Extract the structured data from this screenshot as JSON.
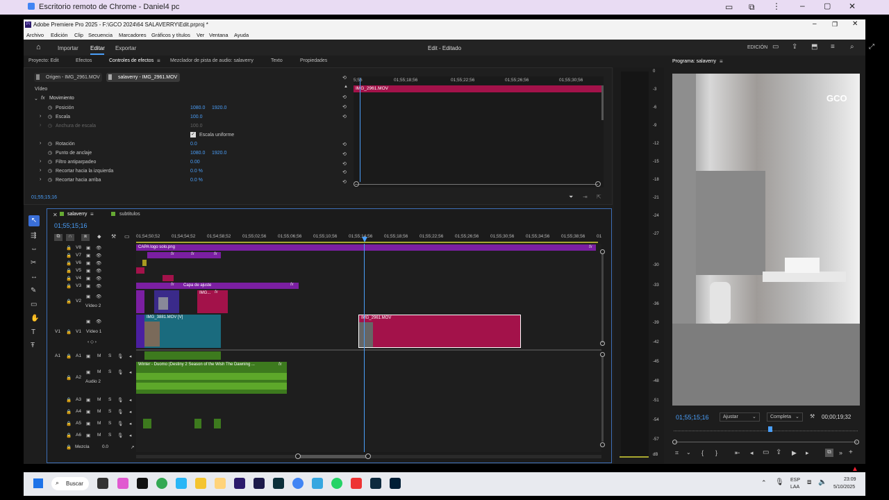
{
  "remote_desktop": {
    "title": "Escritorio remoto de Chrome - Daniel4 pc"
  },
  "app": {
    "title": "Adobe Premiere Pro 2025 - F:\\GCO 2024\\64 SALAVERRY\\Edit.prproj *",
    "menu": [
      "Archivo",
      "Edición",
      "Clip",
      "Secuencia",
      "Marcadores",
      "Gráficos y títulos",
      "Ver",
      "Ventana",
      "Ayuda"
    ],
    "nav": {
      "import": "Importar",
      "edit": "Editar",
      "export": "Exportar"
    },
    "workspace_title": "Edit - Editado",
    "edition_label": "EDICIÓN"
  },
  "panel_tabs": [
    "Proyecto: Edit",
    "Efectos",
    "Controles de efectos",
    "Mezclador de pista de audio: salaverry",
    "Texto",
    "Propiedades"
  ],
  "effect_controls": {
    "source_tab": "Origen - IMG_2961.MOV",
    "seq_tab": "salaverry - IMG_2961.MOV",
    "section": "Vídeo",
    "motion": "Movimiento",
    "rows": [
      {
        "label": "Posición",
        "v1": "1080.0",
        "v2": "1920.0"
      },
      {
        "label": "Escala",
        "v1": "100.0",
        "v2": ""
      },
      {
        "label": "Anchura de escala",
        "v1": "100.0",
        "v2": ""
      },
      {
        "label": "Escala uniforme",
        "v1": "",
        "v2": ""
      },
      {
        "label": "Rotación",
        "v1": "0.0",
        "v2": ""
      },
      {
        "label": "Punto de anclaje",
        "v1": "1080.0",
        "v2": "1920.0"
      },
      {
        "label": "Filtro antiparpadeo",
        "v1": "0.00",
        "v2": ""
      },
      {
        "label": "Recortar hacia la izquierda",
        "v1": "0.0 %",
        "v2": ""
      },
      {
        "label": "Recortar hacia arriba",
        "v1": "0.0 %",
        "v2": ""
      }
    ],
    "timecode": "01;55;15;16",
    "mini_ruler": [
      "5;56",
      "01;55;18;56",
      "01;55;22;56",
      "01;55;26;56",
      "01;55;30;56"
    ],
    "mini_clip": "IMG_2961.MOV"
  },
  "timeline": {
    "tabs": [
      "salaverry",
      "subtitulos"
    ],
    "timecode": "01;55;15;16",
    "ruler": [
      "01;54;50;52",
      "01;54;54;52",
      "01;54;58;52",
      "01;55;02;56",
      "01;55;06;56",
      "01;55;10;56",
      "01;55;14;56",
      "01;55;18;56",
      "01;55;22;56",
      "01;55;26;56",
      "01;55;30;56",
      "01;55;34;56",
      "01;55;38;56",
      "01"
    ],
    "video_tracks": [
      {
        "id": "V8",
        "label": ""
      },
      {
        "id": "V7",
        "label": ""
      },
      {
        "id": "V6",
        "label": ""
      },
      {
        "id": "V5",
        "label": ""
      },
      {
        "id": "V4",
        "label": ""
      },
      {
        "id": "V3",
        "label": ""
      },
      {
        "id": "V2",
        "label": "Vídeo 2"
      },
      {
        "id": "V1",
        "label": "Vídeo 1"
      }
    ],
    "audio_tracks": [
      {
        "id": "A1",
        "label": ""
      },
      {
        "id": "A2",
        "label": "Audio 2"
      },
      {
        "id": "A3",
        "label": ""
      },
      {
        "id": "A4",
        "label": ""
      },
      {
        "id": "A5",
        "label": ""
      },
      {
        "id": "A6",
        "label": ""
      }
    ],
    "mix_label": "Mezcla",
    "mix_value": "0.0",
    "clips": {
      "capa_logo": "CAPA logo solo.png",
      "capa_ajuste": "Capa de ajuste",
      "img_small": "IMG...",
      "img3881": "IMG_3881.MOV [V]",
      "img2961": "IMG_2961.MOV",
      "music": "Winter - Duomo (Destiny 2 Season of the Wish The Dawning ..."
    },
    "fx": "fx"
  },
  "meter": {
    "ticks": [
      "0",
      "-3",
      "-6",
      "-9",
      "-12",
      "-15",
      "-18",
      "-21",
      "-24",
      "-27",
      "-30",
      "-33",
      "-36",
      "-39",
      "-42",
      "-45",
      "-48",
      "-51",
      "-54",
      "-57",
      "dB"
    ]
  },
  "program": {
    "title": "Programa: salaverry",
    "watermark": "GCO",
    "timecode": "01;55;15;16",
    "fit": "Ajustar",
    "quality": "Completa",
    "duration": "00;00;19;32"
  },
  "taskbar": {
    "search": "Buscar",
    "lang1": "ESP",
    "lang2": "LAA",
    "time": "23:09",
    "date": "5/10/2025"
  },
  "colors": {
    "accent": "#4a9ffa",
    "magenta": "#a3124a",
    "purple": "#6b1fa0",
    "teal": "#1a6b7e",
    "audio_green": "#3d7a1e"
  }
}
